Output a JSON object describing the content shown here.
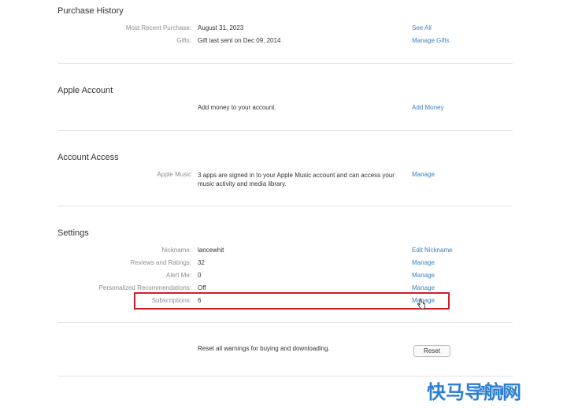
{
  "purchase_history": {
    "title": "Purchase History",
    "rows": [
      {
        "label": "Most Recent Purchase:",
        "value": "August 31, 2023",
        "link": "See All"
      },
      {
        "label": "Gifts:",
        "value": "Gift last sent on Dec 09, 2014",
        "link": "Manage Gifts"
      }
    ]
  },
  "apple_account": {
    "title": "Apple Account",
    "value": "Add money to your account.",
    "link": "Add Money"
  },
  "account_access": {
    "title": "Account Access",
    "label": "Apple Music",
    "value": "3 apps are signed in to your Apple Music account and can access your music activity and media library.",
    "link": "Manage"
  },
  "settings": {
    "title": "Settings",
    "rows": [
      {
        "label": "Nickname:",
        "value": "lancewhit",
        "link": "Edit Nickname"
      },
      {
        "label": "Reviews and Ratings:",
        "value": "32",
        "link": "Manage"
      },
      {
        "label": "Alert Me:",
        "value": "0",
        "link": "Manage"
      },
      {
        "label": "Personalized Recommendations:",
        "value": "Off",
        "link": "Manage"
      },
      {
        "label": "Subscriptions:",
        "value": "6",
        "link": "Manage"
      }
    ]
  },
  "reset": {
    "value": "Reset all warnings for buying and downloading.",
    "button": "Reset"
  },
  "watermark": {
    "text": "快马导航网"
  },
  "colors": {
    "link": "#3b82c4",
    "highlight": "#d11f2a",
    "watermark": "#2f7fd1"
  }
}
